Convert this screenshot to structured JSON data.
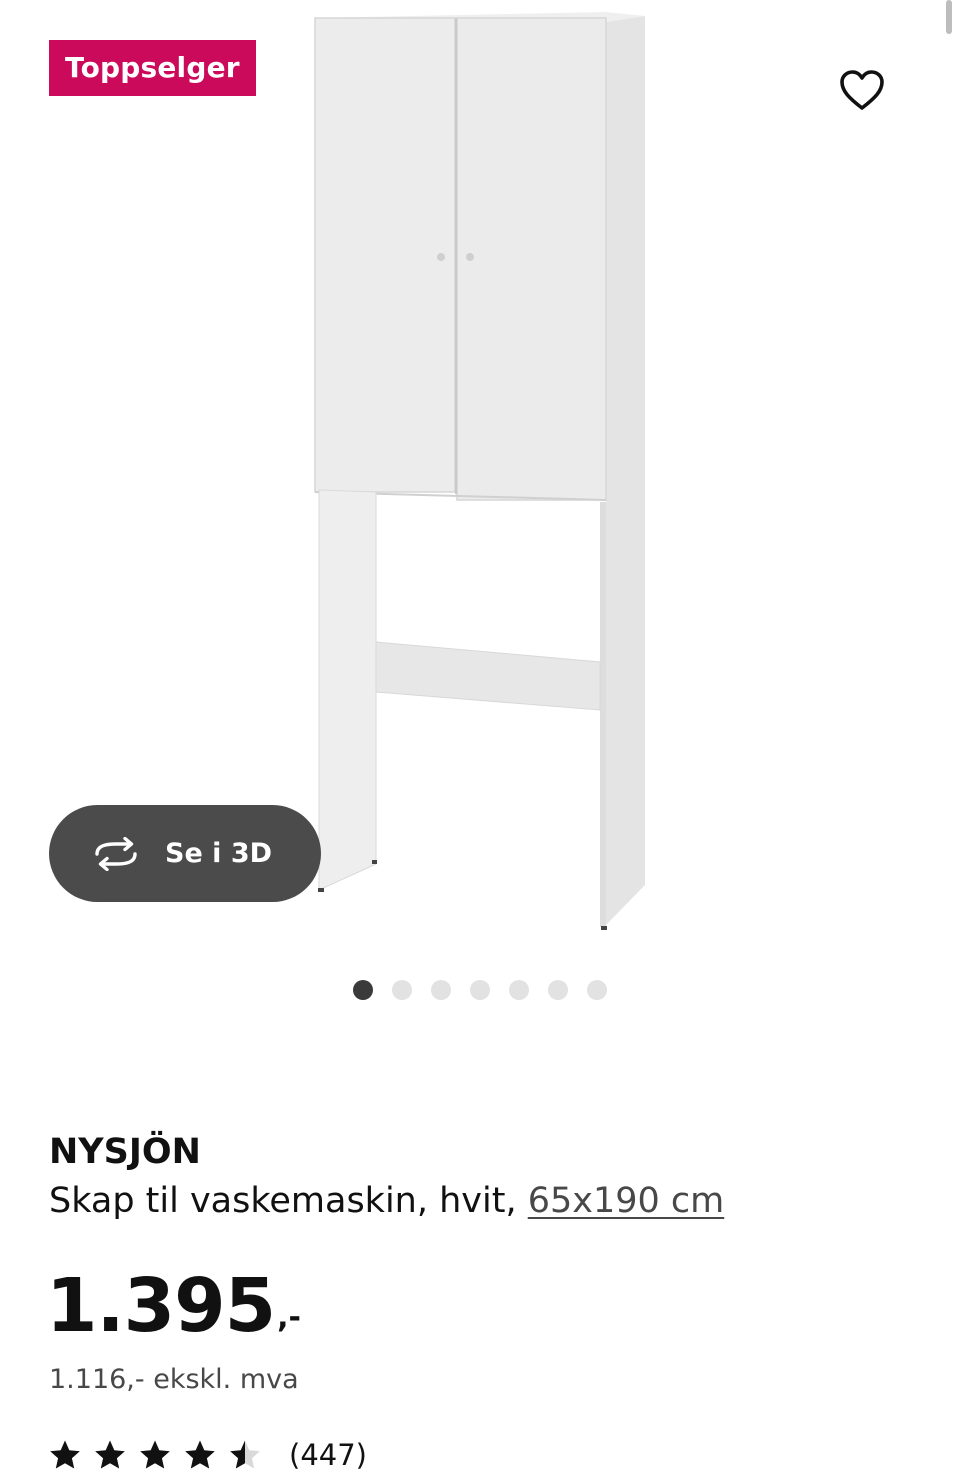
{
  "badge": {
    "label": "Toppselger",
    "color": "#cc0a5b"
  },
  "favorite": {
    "icon": "heart-outline-icon"
  },
  "view_3d": {
    "label": "Se i 3D",
    "icon": "rotate-3d-icon"
  },
  "gallery": {
    "image_count": 7,
    "active_index": 0
  },
  "product": {
    "name": "NYSJÖN",
    "description": "Skap til vaskemaskin, hvit, ",
    "size_link": "65x190 cm"
  },
  "price": {
    "integer": "1.395",
    "suffix": ",-",
    "excl_vat": "1.116,- ekskl. mva"
  },
  "rating": {
    "stars": 4.5,
    "max_stars": 5,
    "count": "(447)"
  }
}
